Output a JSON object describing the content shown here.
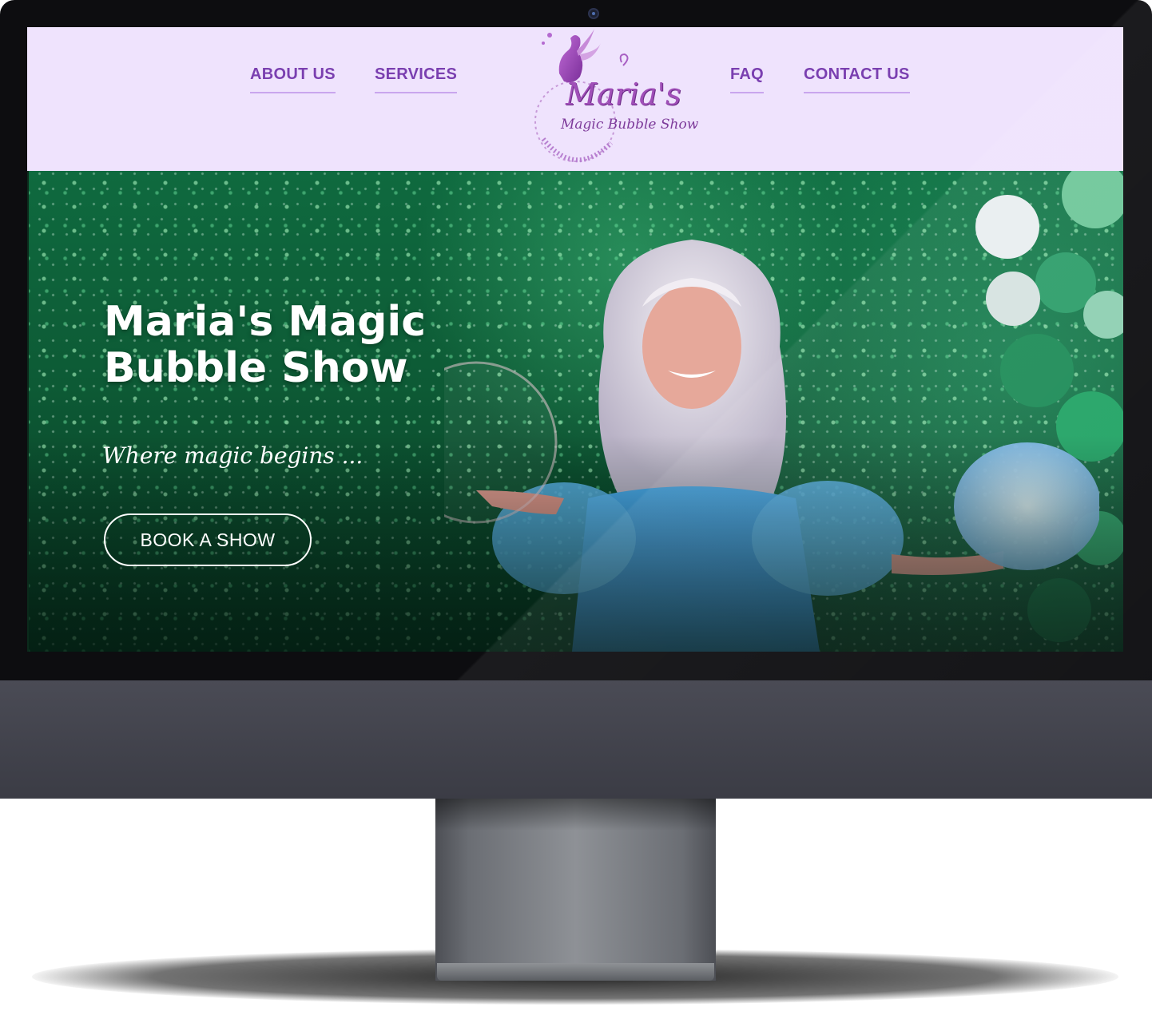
{
  "nav": {
    "about": "ABOUT US",
    "services": "SERVICES",
    "faq": "FAQ",
    "contact": "CONTACT US"
  },
  "logo": {
    "line1": "Maria's",
    "line2": "Magic Bubble Show",
    "icon": "fairy-on-moon-icon"
  },
  "hero": {
    "title": "Maria's Magic Bubble Show",
    "tagline": "Where magic begins ...",
    "cta": "BOOK A SHOW"
  },
  "colors": {
    "header_bg": "#efe3fd",
    "nav_text": "#7a3fb0",
    "nav_underline": "#c9a6ee",
    "hero_green": "#0d5a35",
    "button_border": "#ffffff"
  }
}
